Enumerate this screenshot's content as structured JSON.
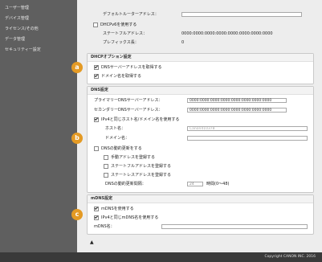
{
  "sidebar": {
    "items": [
      {
        "label": "ユーザー管理"
      },
      {
        "label": "デバイス管理"
      },
      {
        "label": "ライセンス/その他"
      },
      {
        "label": "データ管理"
      },
      {
        "label": "セキュリティー設定"
      }
    ]
  },
  "top": {
    "gateway_label": "デフォルトルーターアドレス：",
    "dhcpv6_label": "DHCPv6を使用する",
    "stateful_label": "ステートフルアドレス：",
    "stateful_value": "0000:0000:0000:0000:0000:0000:0000:0000",
    "prefix_label": "プレフィックス長：",
    "prefix_value": "0"
  },
  "dhcp": {
    "title": "DHCPオプション設定",
    "get_dns": "DNSサーバーアドレスを取得する",
    "get_domain": "ドメイン名を取得する"
  },
  "dns": {
    "title": "DNS設定",
    "primary_label": "プライマリーDNSサーバーアドレス：",
    "primary_value": "0000:0000:0000:0000:0000:0000:0000:0000",
    "secondary_label": "セカンダリーDNSサーバーアドレス：",
    "secondary_value": "0000:0000:0000:0000:0000:0000:0000:0000",
    "same_host": "IPv4と同じホスト名/ドメイン名を使用する",
    "host_label": "ホスト名：",
    "host_placeholder": "Canon410378",
    "domain_label": "ドメイン名：",
    "dynamic_update": "DNSの動的更新をする",
    "manual_addr": "手動アドレスを登録する",
    "stateful_addr": "ステートフルアドレスを登録する",
    "stateless_addr": "ステートレスアドレスを登録する",
    "interval_label": "DNSの動的更新間隔：",
    "interval_value": "24",
    "interval_unit": "時間(0～48)"
  },
  "mdns": {
    "title": "mDNS設定",
    "use": "mDNSを使用する",
    "same_name": "IPv4と同じmDNS名を使用する",
    "name_label": "mDNS名："
  },
  "callouts": {
    "a": "a",
    "b": "b",
    "c": "c"
  },
  "footer": {
    "copyright": "Copyright CANON INC. 2016"
  }
}
